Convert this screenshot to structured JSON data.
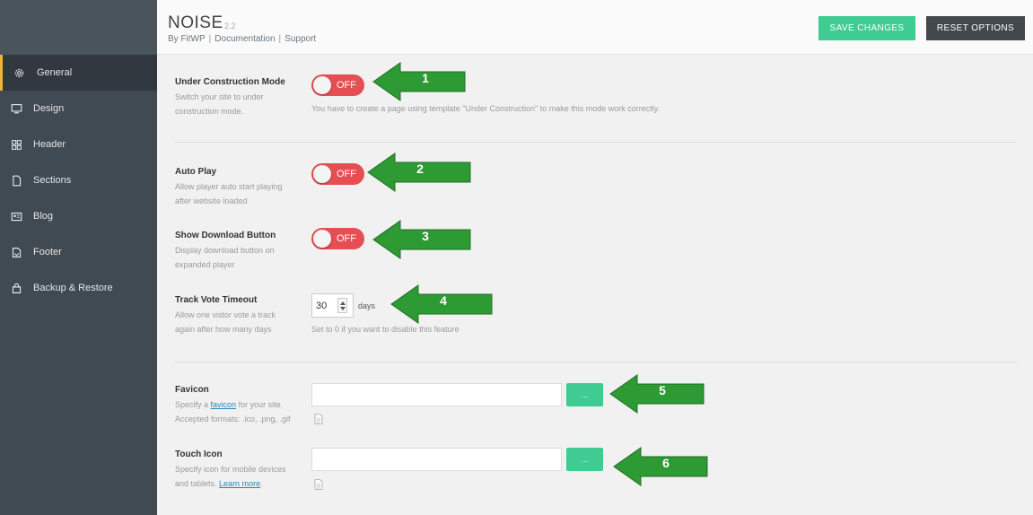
{
  "header": {
    "title": "NOISE",
    "version": "2.2",
    "by": "By FitWP",
    "documentation": "Documentation",
    "support": "Support",
    "save_label": "SAVE CHANGES",
    "reset_label": "RESET OPTIONS"
  },
  "sidebar": {
    "items": [
      {
        "label": "General",
        "icon": "gear-icon"
      },
      {
        "label": "Design",
        "icon": "monitor-icon"
      },
      {
        "label": "Header",
        "icon": "grid-icon"
      },
      {
        "label": "Sections",
        "icon": "document-icon"
      },
      {
        "label": "Blog",
        "icon": "picture-icon"
      },
      {
        "label": "Footer",
        "icon": "footer-icon"
      },
      {
        "label": "Backup & Restore",
        "icon": "backup-icon"
      }
    ]
  },
  "options": {
    "under_construction": {
      "label": "Under Construction Mode",
      "desc": "Switch your site to under construction mode.",
      "toggle": "OFF",
      "hint": "You have to create a page using template \"Under Construction\" to make this mode work correctly."
    },
    "auto_play": {
      "label": "Auto Play",
      "desc": "Allow player auto start playing after website loaded",
      "toggle": "OFF"
    },
    "show_download": {
      "label": "Show Download Button",
      "desc": "Display download button on expanded player",
      "toggle": "OFF"
    },
    "track_vote": {
      "label": "Track Vote Timeout",
      "desc": "Allow one vistor vote a track again after how many days",
      "value": "30",
      "unit": "days",
      "hint": "Set to 0 if you want to disable this feature"
    },
    "favicon": {
      "label": "Favicon",
      "desc_pre": "Specify a ",
      "desc_link": "favicon",
      "desc_post": " for your site.",
      "desc_formats": "Accepted formats: .ico, .png, .gif",
      "value": "",
      "browse_label": "..."
    },
    "touch_icon": {
      "label": "Touch Icon",
      "desc_pre": "Specify icon for mobile devices and tablets. ",
      "desc_link": "Learn more",
      "desc_post": ".",
      "value": "",
      "browse_label": "..."
    }
  },
  "annotations": [
    "1",
    "2",
    "3",
    "4",
    "5",
    "6"
  ],
  "colors": {
    "sidebar_bg": "#404a52",
    "active_accent": "#f2b134",
    "save_button": "#3fcb91",
    "reset_button": "#42484d",
    "toggle_off": "#e54e53",
    "annotation_arrow": "#2e9a33"
  }
}
